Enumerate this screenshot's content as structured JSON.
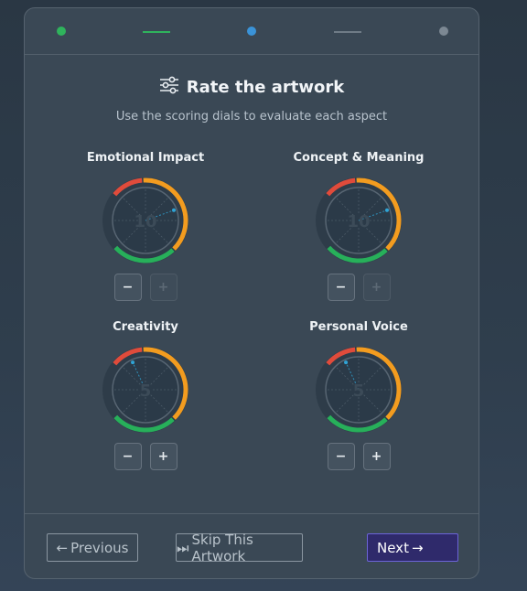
{
  "stepper": {
    "colors": {
      "done": "#2fb35c",
      "active": "#3a93d8",
      "pending": "#7c8893",
      "line_done": "#2fb35c",
      "line_pending": "#6f7b86"
    }
  },
  "header": {
    "icon": "sliders-icon",
    "title": "Rate the artwork",
    "subtitle": "Use the scoring dials to evaluate each aspect"
  },
  "dials": [
    {
      "key": "emotional",
      "label": "Emotional Impact",
      "value": "10",
      "minus_label": "−",
      "plus_label": "+",
      "plus_enabled": false
    },
    {
      "key": "concept",
      "label": "Concept & Meaning",
      "value": "10",
      "minus_label": "−",
      "plus_label": "+",
      "plus_enabled": false
    },
    {
      "key": "creativity",
      "label": "Creativity",
      "value": "5",
      "minus_label": "−",
      "plus_label": "+",
      "plus_enabled": true
    },
    {
      "key": "voice",
      "label": "Personal Voice",
      "value": "5",
      "minus_label": "−",
      "plus_label": "+",
      "plus_enabled": true
    }
  ],
  "dial_colors": {
    "red": "#e04b3b",
    "orange": "#f39c1f",
    "green": "#27b05a",
    "face": "#2b3a48",
    "needle": "#2fa4d6"
  },
  "footer": {
    "previous_label": "Previous",
    "skip_label": "Skip This Artwork",
    "next_label": "Next"
  }
}
